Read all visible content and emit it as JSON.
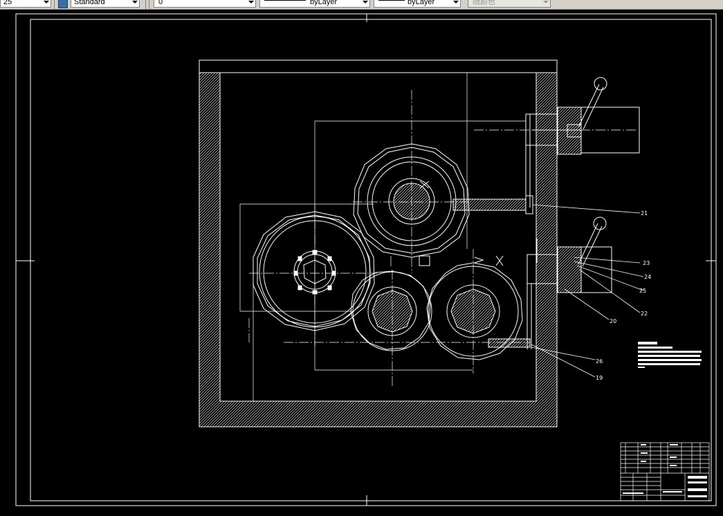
{
  "toolbar": {
    "linetype_scale": "25",
    "text_style": "Standard",
    "layer": "0",
    "linetype": "byLayer",
    "lineweight": "byLayer",
    "color": "随颜色"
  },
  "drawing": {
    "labels": [
      "21",
      "23",
      "24",
      "25",
      "22",
      "20",
      "26",
      "19"
    ]
  },
  "colors": {
    "background": "#000000",
    "lines": "#ffffff",
    "toolbar": "#d4d0c8"
  }
}
